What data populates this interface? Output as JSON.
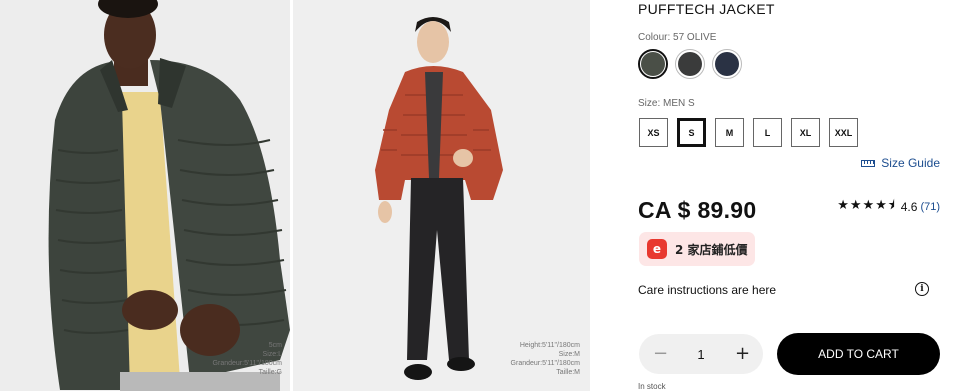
{
  "product": {
    "title": "PUFFTECH JACKET",
    "colour_label": "Colour: 57 OLIVE",
    "size_label": "Size: MEN S",
    "swatches": [
      {
        "name": "olive",
        "color": "#4a4f47",
        "selected": true
      },
      {
        "name": "dark-grey",
        "color": "#3a3b3b",
        "selected": false
      },
      {
        "name": "navy",
        "color": "#2a3244",
        "selected": false
      }
    ],
    "sizes": [
      "XS",
      "S",
      "M",
      "L",
      "XL",
      "XXL"
    ],
    "selected_size": "S",
    "size_guide": "Size Guide",
    "price": "CA $ 89.90",
    "stars": "★★★★⯨",
    "rating": "4.6",
    "review_count": "(71)",
    "deal_logo": "e",
    "deal_text": "2 家店鋪低價",
    "care": "Care instructions are here",
    "info_icon": "i",
    "qty_minus": "−",
    "qty_value": "1",
    "qty_plus": "+",
    "add_to_cart": "ADD TO CART",
    "stock": "In stock"
  },
  "gallery": {
    "image1_info": [
      "5cm",
      "Size:L",
      "Grandeur:5'11\"/180cm",
      "Taille:G"
    ],
    "image2_info": [
      "Height:5'11\"/180cm",
      "Size:M",
      "Grandeur:5'11\"/180cm",
      "Taille:M"
    ]
  },
  "colors": {
    "accent_link": "#1c4d8f",
    "cart_button": "#000000",
    "jacket_1": "#3f4640",
    "jacket_2": "#b94a32",
    "deal_bg": "#fde6e6",
    "deal_logo": "#e8382f"
  }
}
